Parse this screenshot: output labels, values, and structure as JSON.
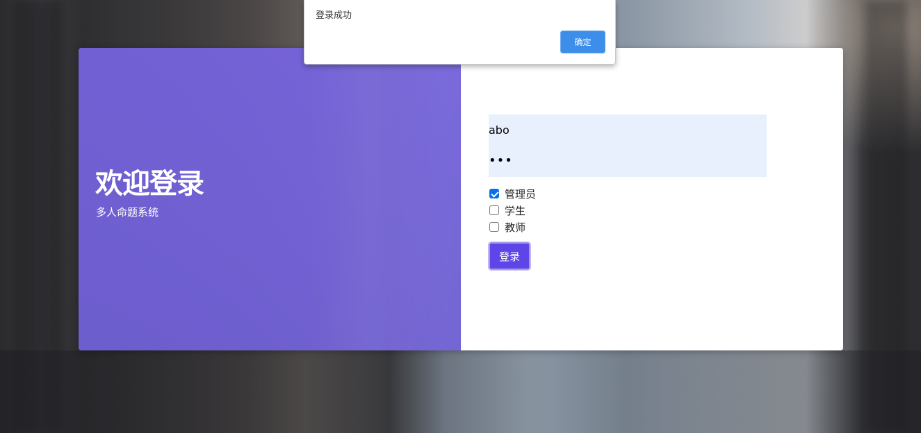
{
  "alert": {
    "message": "登录成功",
    "ok_label": "确定",
    "button_color": "#3d8eea"
  },
  "welcome": {
    "title": "欢迎登录",
    "subtitle": "多人命题系统",
    "panel_color": "#7664e0"
  },
  "login": {
    "username_value": "abo",
    "password_value": "•••",
    "roles": [
      {
        "label": "管理员",
        "checked": true
      },
      {
        "label": "学生",
        "checked": false
      },
      {
        "label": "教师",
        "checked": false
      }
    ],
    "submit_label": "登录",
    "button_color": "#5d45e8",
    "input_bg_color": "#e8f0fe"
  }
}
